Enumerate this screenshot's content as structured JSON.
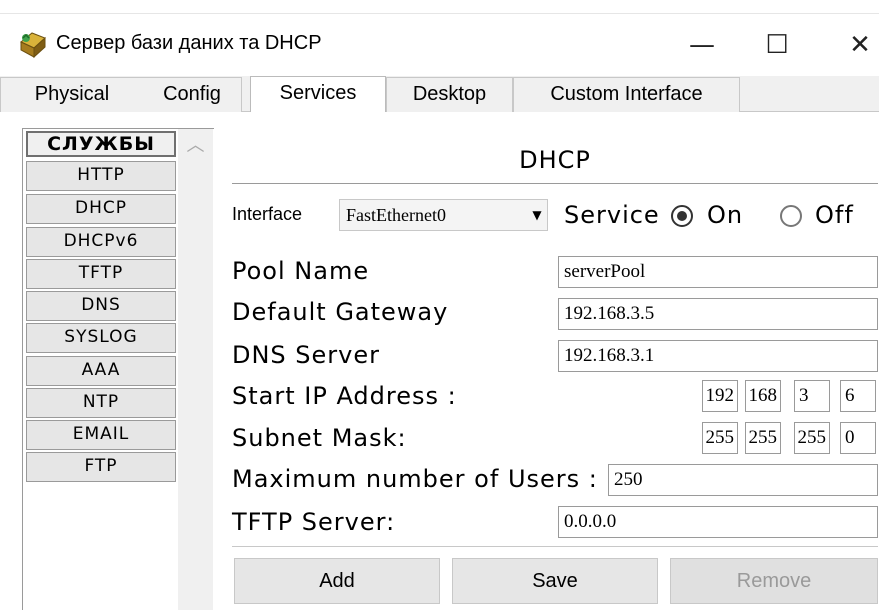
{
  "window": {
    "title": "Сервер бази даних та DHCP",
    "controls": {
      "minimize": "—",
      "maximize": "☐",
      "close": "✕"
    }
  },
  "tabs": [
    {
      "label": "Physical",
      "active": false
    },
    {
      "label": "Config",
      "active": false
    },
    {
      "label": "Services",
      "active": true
    },
    {
      "label": "Desktop",
      "active": false
    },
    {
      "label": "Custom Interface",
      "active": false
    }
  ],
  "services": {
    "header": "СЛУЖБЫ",
    "items": [
      "HTTP",
      "DHCP",
      "DHCPv6",
      "TFTP",
      "DNS",
      "SYSLOG",
      "AAA",
      "NTP",
      "EMAIL",
      "FTP"
    ],
    "scroll_up_icon": "chevron-up-icon"
  },
  "dhcp": {
    "title": "DHCP",
    "interface_label": "Interface",
    "interface_value": "FastEthernet0",
    "service_label": "Service",
    "on_label": "On",
    "off_label": "Off",
    "service_on": true,
    "pool_name_label": "Pool Name",
    "pool_name_value": "serverPool",
    "gateway_label": "Default Gateway",
    "gateway_value": "192.168.3.5",
    "dns_label": "DNS Server",
    "dns_value": "192.168.3.1",
    "start_ip_label": "Start IP Address :",
    "start_ip": [
      "192",
      "168",
      "3",
      "6"
    ],
    "subnet_label": "Subnet Mask:",
    "subnet": [
      "255",
      "255",
      "255",
      "0"
    ],
    "max_users_label": "Maximum number of Users :",
    "max_users_value": "250",
    "tftp_label": "TFTP Server:",
    "tftp_value": "0.0.0.0",
    "buttons": {
      "add": "Add",
      "save": "Save",
      "remove": "Remove"
    }
  }
}
